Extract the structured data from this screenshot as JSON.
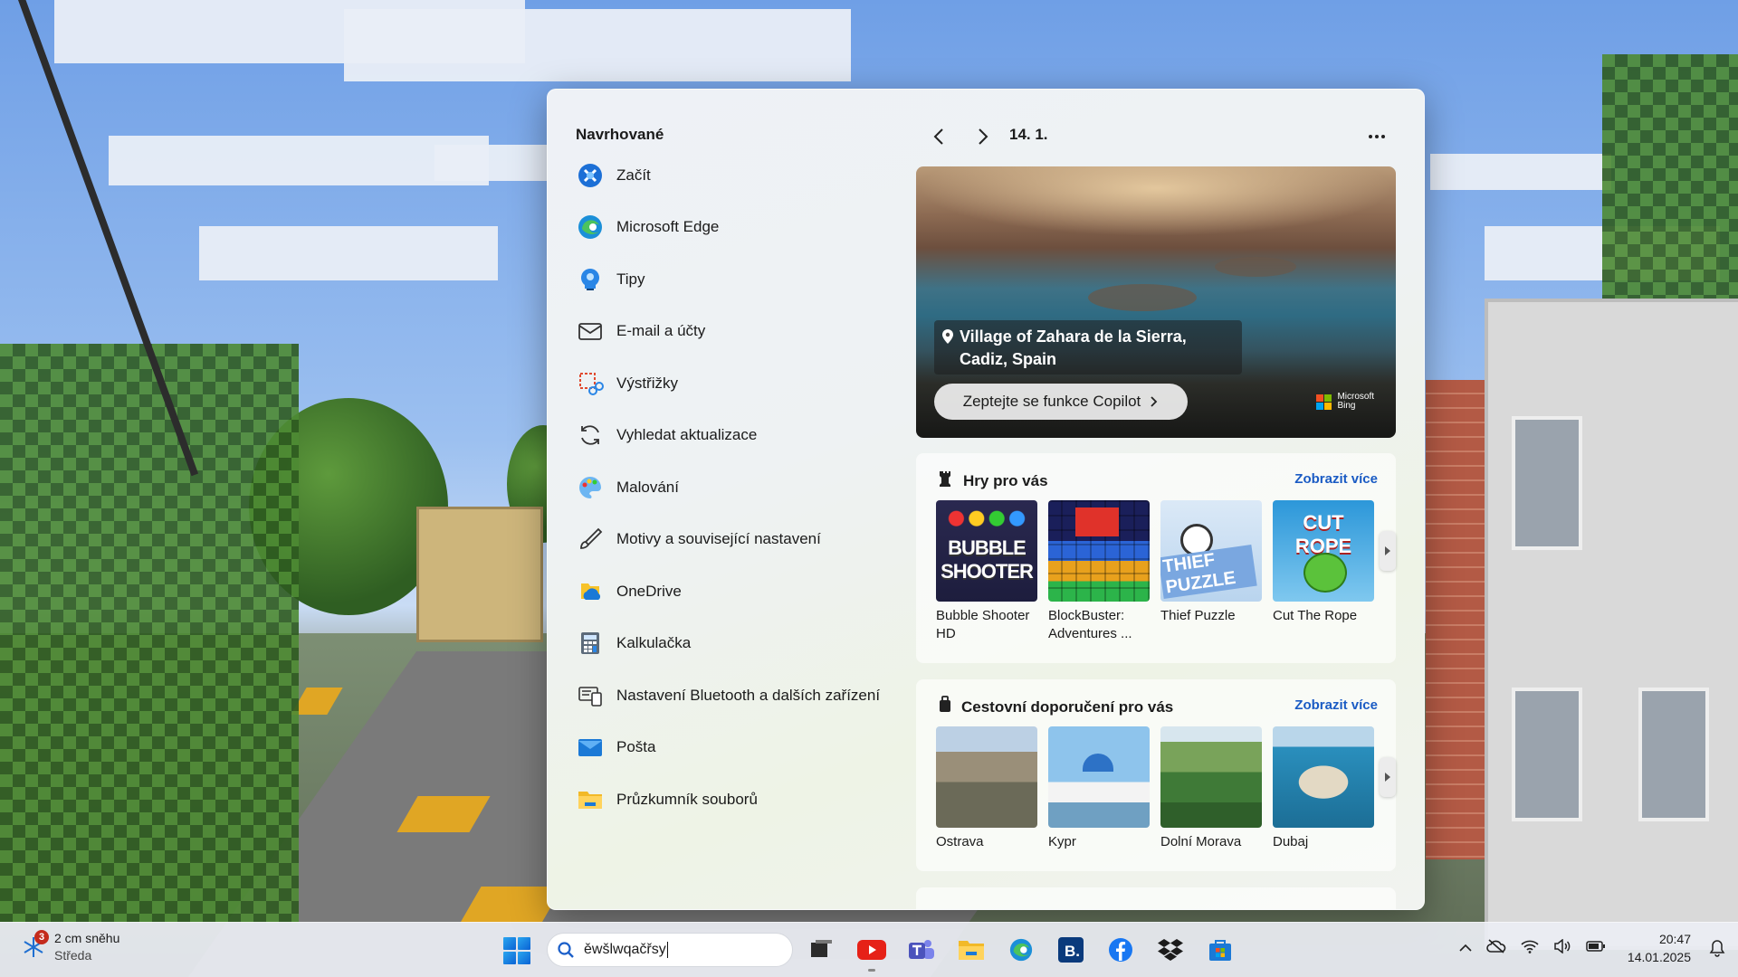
{
  "start": {
    "suggested_title": "Navrhované",
    "date_label": "14. 1.",
    "apps": [
      {
        "label": "Začít",
        "icon": "get-started-icon"
      },
      {
        "label": "Microsoft Edge",
        "icon": "edge-icon"
      },
      {
        "label": "Tipy",
        "icon": "tips-icon"
      },
      {
        "label": "E-mail a účty",
        "icon": "mail-accounts-icon"
      },
      {
        "label": "Výstřižky",
        "icon": "snipping-icon"
      },
      {
        "label": "Vyhledat aktualizace",
        "icon": "refresh-icon"
      },
      {
        "label": "Malování",
        "icon": "paint-icon"
      },
      {
        "label": "Motivy a související nastavení",
        "icon": "brush-icon"
      },
      {
        "label": "OneDrive",
        "icon": "onedrive-icon"
      },
      {
        "label": "Kalkulačka",
        "icon": "calculator-icon"
      },
      {
        "label": "Nastavení Bluetooth a dalších zařízení",
        "icon": "devices-icon"
      },
      {
        "label": "Pošta",
        "icon": "mail-icon"
      },
      {
        "label": "Průzkumník souborů",
        "icon": "folder-icon"
      }
    ],
    "hero": {
      "location_line1": "Village of Zahara de la Sierra,",
      "location_line2": "Cadiz, Spain",
      "copilot_label": "Zeptejte se funkce Copilot",
      "bing_line1": "Microsoft",
      "bing_line2": "Bing"
    },
    "games": {
      "title": "Hry pro vás",
      "see_more": "Zobrazit více",
      "items": [
        {
          "label": "Bubble Shooter HD",
          "art_text": "BUBBLE SHOOTER"
        },
        {
          "label": "BlockBuster: Adventures ...",
          "art_text": ""
        },
        {
          "label": "Thief Puzzle",
          "art_text": "THIEF PUZZLE"
        },
        {
          "label": "Cut The Rope",
          "art_text": "CUT ROPE"
        }
      ]
    },
    "travel": {
      "title": "Cestovní doporučení pro vás",
      "see_more": "Zobrazit více",
      "items": [
        {
          "label": "Ostrava"
        },
        {
          "label": "Kypr"
        },
        {
          "label": "Dolní Morava"
        },
        {
          "label": "Dubaj"
        }
      ]
    }
  },
  "taskbar": {
    "weather_temp": "2 cm sněhu",
    "weather_day": "Středa",
    "weather_badge": "3",
    "search_value": "ěwšlwqačřsy",
    "time": "20:47",
    "date": "14.01.2025",
    "apps": [
      "task-view-icon",
      "youtube-icon",
      "teams-icon",
      "file-explorer-icon",
      "edge-icon",
      "booking-icon",
      "facebook-icon",
      "dropbox-icon",
      "store-icon"
    ]
  },
  "colors": {
    "accent": "#1a5bc4",
    "badge": "#c42b1c"
  }
}
